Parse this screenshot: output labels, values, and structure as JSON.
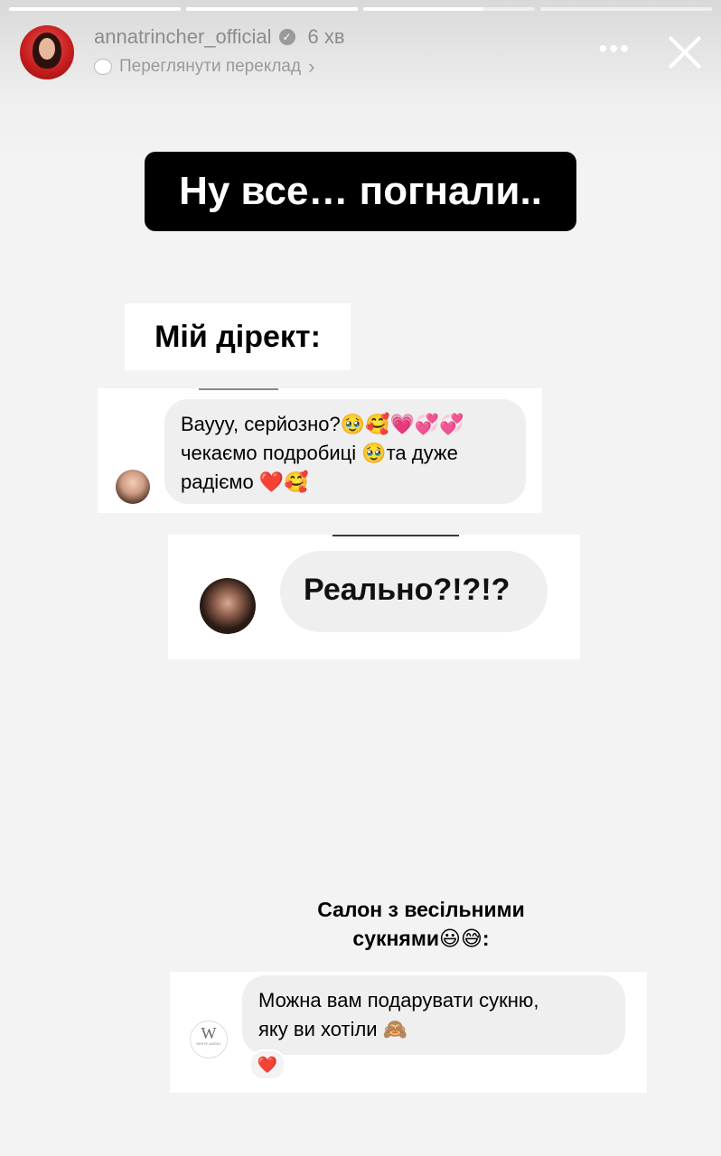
{
  "story": {
    "progress_segments": [
      1.0,
      1.0,
      0.7,
      0.0
    ],
    "username": "annatrincher_official",
    "time": "6 хв",
    "translate_label": "Переглянути переклад",
    "more_icon": "more-horizontal-icon",
    "close_icon": "close-icon"
  },
  "headline": "Ну все… погнали..",
  "direct_label": "Мій дірект:",
  "messages": [
    {
      "lines": [
        "Вауyy, серйозно?🥹🥰💗💞💞",
        "чекаємо подробиці 🥹та дуже",
        "радіємо ❤️🥰"
      ]
    },
    {
      "text": "Реально?!?!?"
    }
  ],
  "salon_label_lines": [
    "Салон з весільними",
    "сукнями😃😅:"
  ],
  "salon_message": {
    "lines": [
      "Можна вам подарувати сукню,",
      "яку ви хотіли 🙈"
    ],
    "avatar_text": "WHITE ANGEL",
    "reaction": "❤️"
  },
  "colors": {
    "bubble": "#efefef",
    "headline_bg": "#000000",
    "heart": "#e0202e"
  }
}
